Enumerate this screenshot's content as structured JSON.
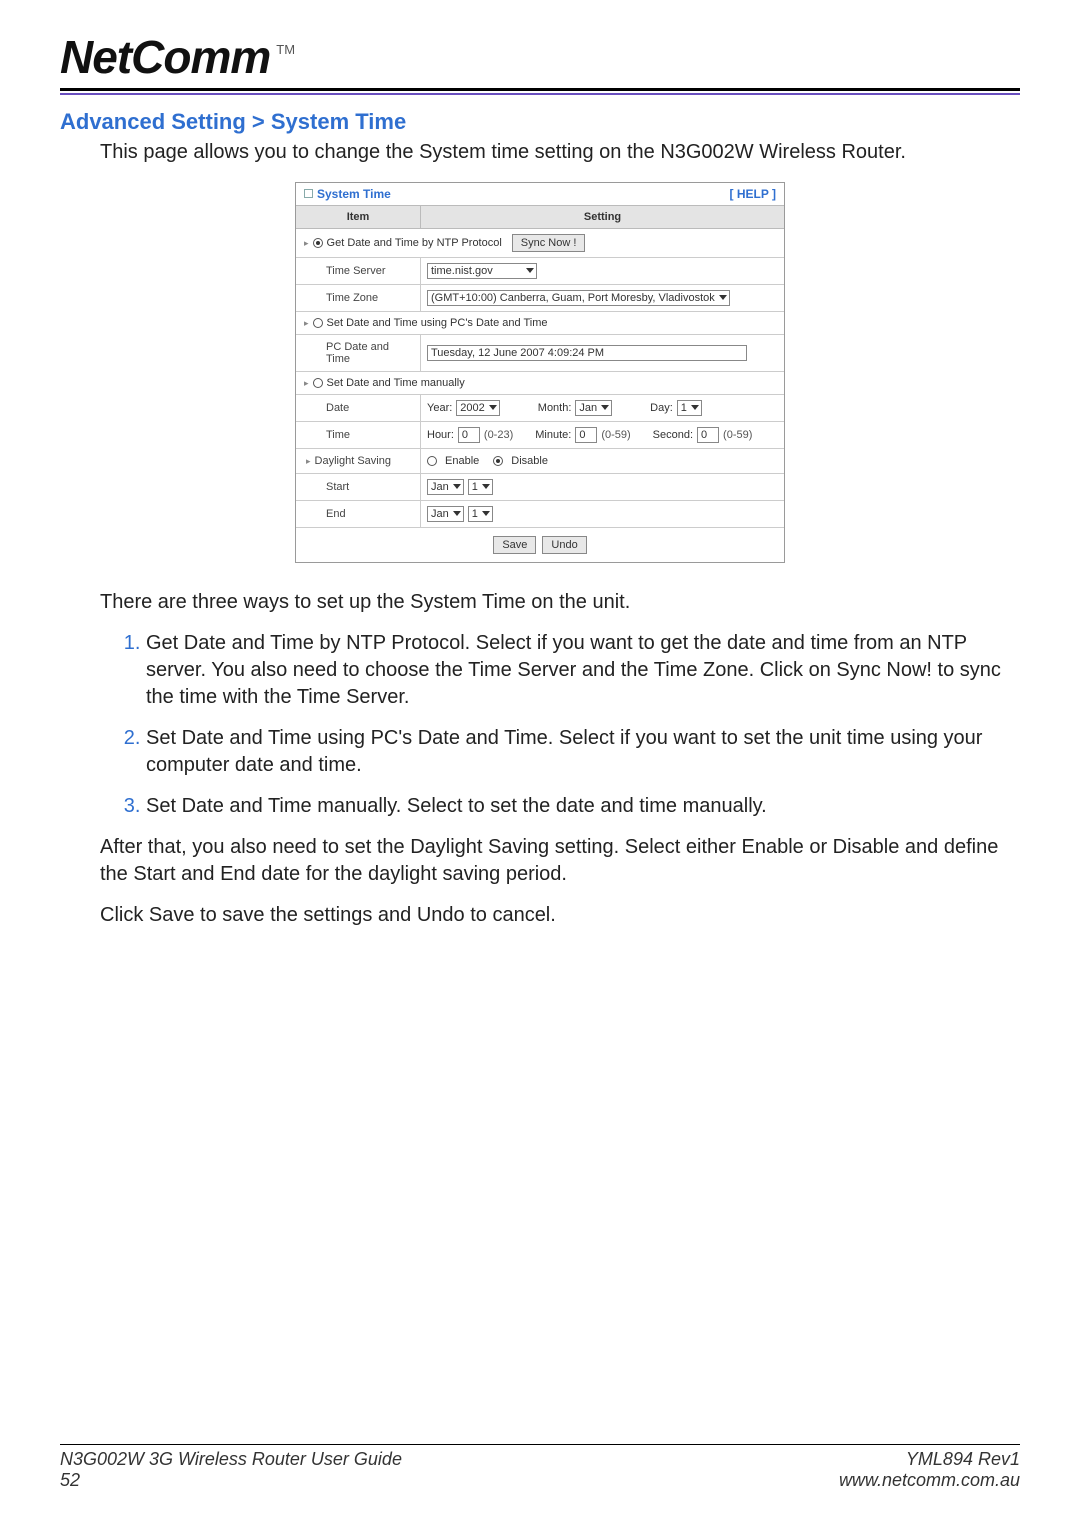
{
  "logo": {
    "text": "NetComm",
    "tm": "TM"
  },
  "sectionTitle": "Advanced Setting > System Time",
  "intro": "This page allows you to change the System time setting on the N3G002W Wireless Router.",
  "router": {
    "title": "System Time",
    "help": "[ HELP ]",
    "header": {
      "item": "Item",
      "setting": "Setting"
    },
    "opt1": {
      "label": "Get Date and Time by NTP Protocol",
      "syncBtn": "Sync Now !"
    },
    "timeServer": {
      "label": "Time Server",
      "value": "time.nist.gov"
    },
    "timeZone": {
      "label": "Time Zone",
      "value": "(GMT+10:00) Canberra, Guam, Port Moresby, Vladivostok"
    },
    "opt2": {
      "label": "Set Date and Time using PC's Date and Time"
    },
    "pcDate": {
      "label": "PC Date and Time",
      "value": "Tuesday, 12 June 2007 4:09:24 PM"
    },
    "opt3": {
      "label": "Set Date and Time manually"
    },
    "date": {
      "label": "Date",
      "yearLabel": "Year:",
      "yearValue": "2002",
      "monthLabel": "Month:",
      "monthValue": "Jan",
      "dayLabel": "Day:",
      "dayValue": "1"
    },
    "time": {
      "label": "Time",
      "hourLabel": "Hour:",
      "hourValue": "0",
      "hourHint": "(0-23)",
      "minuteLabel": "Minute:",
      "minuteValue": "0",
      "minuteHint": "(0-59)",
      "secondLabel": "Second:",
      "secondValue": "0",
      "secondHint": "(0-59)"
    },
    "daylight": {
      "label": "Daylight Saving",
      "enable": "Enable",
      "disable": "Disable"
    },
    "start": {
      "label": "Start",
      "month": "Jan",
      "day": "1"
    },
    "end": {
      "label": "End",
      "month": "Jan",
      "day": "1"
    },
    "buttons": {
      "save": "Save",
      "undo": "Undo"
    }
  },
  "body": {
    "p1": "There are three ways to set up the System Time on the unit.",
    "li1": "Get Date and Time by NTP Protocol. Select if you want to get the date and time from an NTP server. You also need to choose the Time Server and the Time Zone. Click on Sync Now! to sync the time with the Time Server.",
    "li2": "Set Date and Time using PC's Date and Time.  Select if you want to set the unit time using your computer date and time.",
    "li3": "Set Date and Time manually. Select to set the date and time manually.",
    "p2": "After that, you also need to set the Daylight Saving setting. Select either Enable or Disable and define the Start and End date for the daylight saving period.",
    "p3": "Click Save to save the settings and Undo to cancel."
  },
  "footer": {
    "leftTop": "N3G002W 3G Wireless Router User Guide",
    "leftBottom": "52",
    "rightTop": "YML894 Rev1",
    "rightBottom": "www.netcomm.com.au"
  }
}
